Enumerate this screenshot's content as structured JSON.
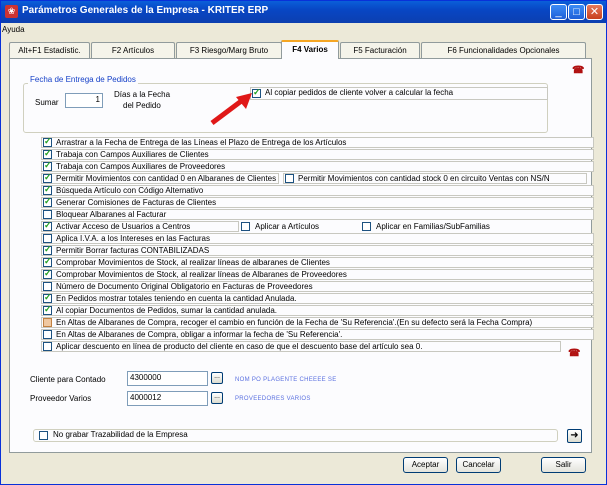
{
  "window": {
    "title": "Parámetros Generales de la Empresa - KRITER ERP"
  },
  "menu": {
    "items": [
      "Ayuda"
    ]
  },
  "tabs": [
    {
      "label": "Alt+F1 Estadístic."
    },
    {
      "label": "F2 Artículos"
    },
    {
      "label": "F3 Riesgo/Marg Bruto"
    },
    {
      "label": "F4 Varios"
    },
    {
      "label": "F5 Facturación"
    },
    {
      "label": "F6 Funcionalidades Opcionales"
    }
  ],
  "fecha_entrega": {
    "legend": "Fecha de Entrega de Pedidos",
    "sumar_label": "Sumar",
    "sumar_value": "1",
    "dias_label_1": "Días a la Fecha",
    "dias_label_2": "del Pedido",
    "copiar_label": "Al copiar pedidos de cliente volver a calcular la fecha",
    "copiar_checked": true
  },
  "options": [
    {
      "label": "Arrastrar a la Fecha de Entrega de las Líneas el Plazo de Entrega de los Artículos",
      "checked": true
    },
    {
      "label": "Trabaja con Campos Auxiliares de Clientes",
      "checked": true
    },
    {
      "label": "Trabaja con Campos Auxiliares de Proveedores",
      "checked": true
    },
    {
      "label": "Permitir Movimientos con cantidad 0 en Albaranes de Clientes",
      "checked": true
    },
    {
      "label": "Búsqueda Artículo con Código Alternativo",
      "checked": true
    },
    {
      "label": "Generar Comisiones de Facturas de Clientes",
      "checked": true
    },
    {
      "label": "Bloquear Albaranes al Facturar",
      "checked": false
    },
    {
      "label": "Activar Acceso de Usuarios a Centros",
      "checked": true
    },
    {
      "label": "Aplica I.V.A. a los Intereses en las Facturas",
      "checked": false
    },
    {
      "label": "Permitir Borrar facturas CONTABILIZADAS",
      "checked": true
    },
    {
      "label": "Comprobar Movimientos de Stock, al realizar líneas de albaranes de Clientes",
      "checked": true
    },
    {
      "label": "Comprobar Movimientos de Stock, al realizar líneas de Albaranes de Proveedores",
      "checked": true
    },
    {
      "label": "Número de Documento Original Obligatorio en Facturas de Proveedores",
      "checked": false
    },
    {
      "label": "En Pedidos mostrar totales teniendo en cuenta la cantidad Anulada.",
      "checked": true
    },
    {
      "label": "Al copiar Documentos de Pedidos, sumar la cantidad anulada.",
      "checked": true
    },
    {
      "label": "En Altas de Albaranes de Compra, recoger el cambio en función de la Fecha de 'Su Referencia'.(En su defecto será la Fecha Compra)",
      "checked": false
    },
    {
      "label": "En Altas de Albaranes de Compra, obligar a informar la fecha de 'Su Referencia'.",
      "checked": false
    },
    {
      "label": "Aplicar descuento en línea de producto del cliente en caso de que el descuento base del artículo sea 0.",
      "checked": false
    }
  ],
  "extra": {
    "stock_ns_label": "Permitir Movimientos con cantidad stock 0 en circuito Ventas con NS/N",
    "aplicar_articulos": "Aplicar a Artículos",
    "aplicar_familias": "Aplicar en Familias/SubFamilias"
  },
  "cliente_contado": {
    "label": "Cliente para Contado",
    "value": "4300000",
    "name": "NOM PO PLAGENTE CHEEEE SE"
  },
  "proveedor_varios": {
    "label": "Proveedor Varios",
    "value": "4000012",
    "name": "PROVEEDORES VARIOS"
  },
  "trazabilidad": {
    "label": "No grabar Trazabilidad de la Empresa",
    "checked": false
  },
  "buttons": {
    "aceptar": "Aceptar",
    "cancelar": "Cancelar",
    "salir": "Salir"
  },
  "colors": {
    "titlebar": "#0846c4",
    "legend": "#1540c8",
    "check": "#21a121"
  }
}
